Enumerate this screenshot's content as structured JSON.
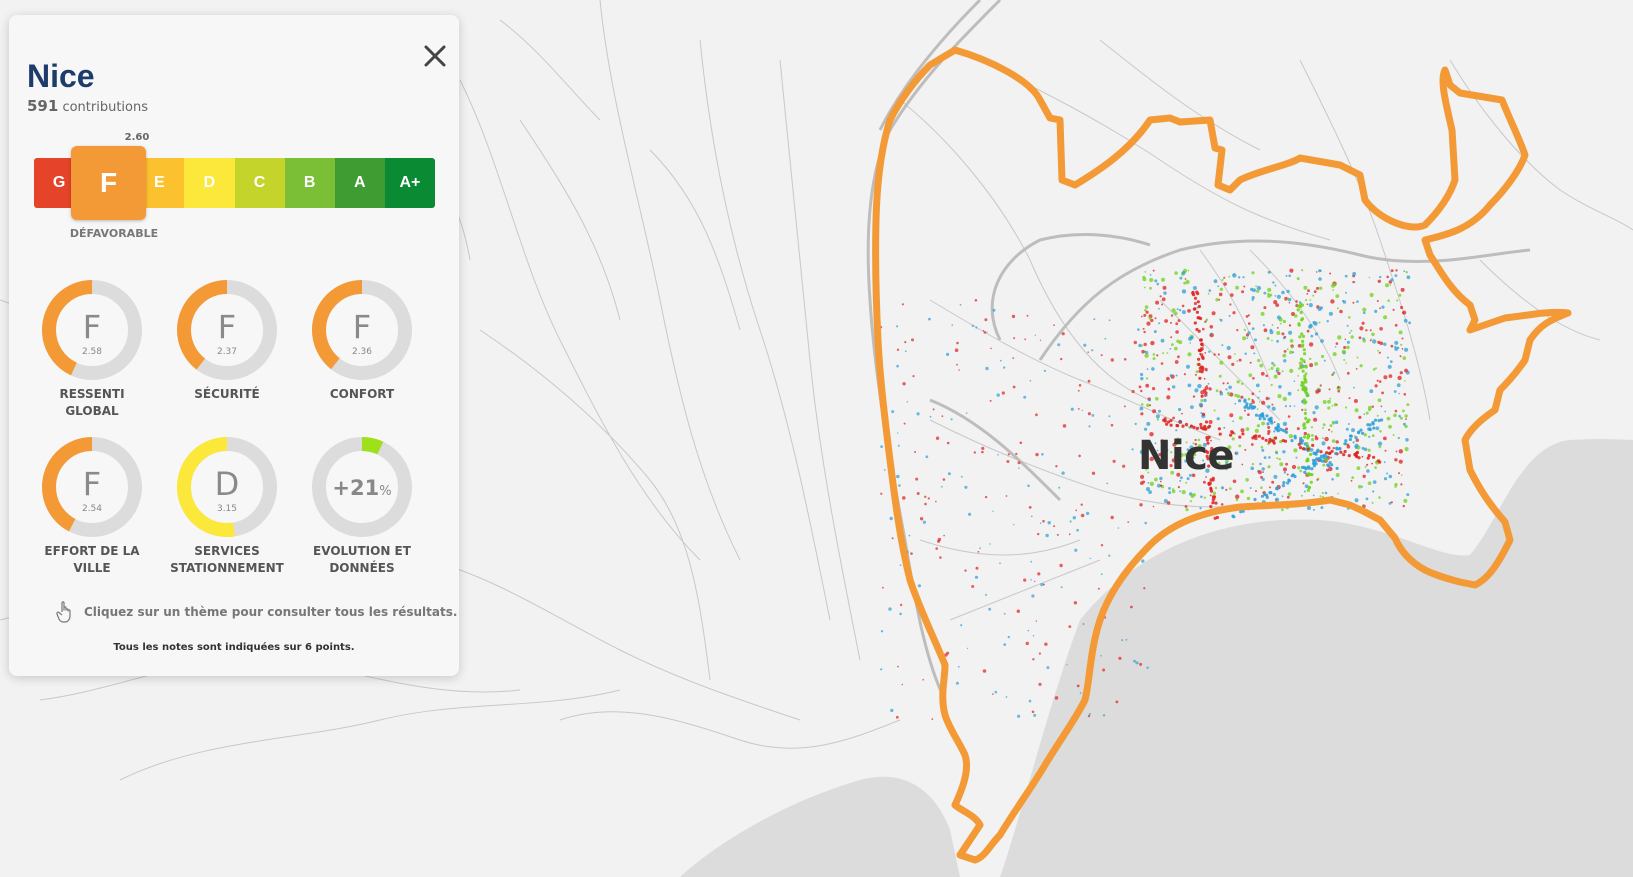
{
  "map": {
    "city_label": "Nice",
    "boundary_color": "#f39a37",
    "dot_colors": [
      "#e02020",
      "#2f9fd6",
      "#6fd21a"
    ]
  },
  "panel": {
    "city": "Nice",
    "contributions_count": "591",
    "contributions_label": "contributions",
    "overall_score": "2.60",
    "overall_grade": "F",
    "overall_word": "DÉFAVORABLE",
    "grade_scale": [
      {
        "label": "G",
        "color": "#e5442a"
      },
      {
        "label": "F",
        "color": "#f39a37"
      },
      {
        "label": "E",
        "color": "#fbc12f"
      },
      {
        "label": "D",
        "color": "#fbe83a"
      },
      {
        "label": "C",
        "color": "#c4d42b"
      },
      {
        "label": "B",
        "color": "#7bbf36"
      },
      {
        "label": "A",
        "color": "#3e9c33"
      },
      {
        "label": "A+",
        "color": "#0a8a32"
      }
    ],
    "gauges": [
      {
        "letter": "F",
        "score": "2.58",
        "label_line1": "RESSENTI",
        "label_line2": "GLOBAL",
        "fraction": 0.43,
        "color": "#f39a37"
      },
      {
        "letter": "F",
        "score": "2.37",
        "label_line1": "SÉCURITÉ",
        "label_line2": "",
        "fraction": 0.395,
        "color": "#f39a37"
      },
      {
        "letter": "F",
        "score": "2.36",
        "label_line1": "CONFORT",
        "label_line2": "",
        "fraction": 0.393,
        "color": "#f39a37"
      },
      {
        "letter": "F",
        "score": "2.54",
        "label_line1": "EFFORT DE LA",
        "label_line2": "VILLE",
        "fraction": 0.423,
        "color": "#f39a37"
      },
      {
        "letter": "D",
        "score": "3.15",
        "label_line1": "SERVICES",
        "label_line2": "STATIONNEMENT",
        "fraction": 0.525,
        "color": "#fbe83a"
      }
    ],
    "evolution": {
      "value": "+21",
      "unit": "%",
      "label_line1": "EVOLUTION ET",
      "label_line2": "DONNÉES",
      "fraction": 0.07,
      "color": "#9ee01a"
    },
    "hint": "Cliquez sur un thème pour consulter tous les résultats.",
    "note": "Tous les notes sont indiquées sur 6 points."
  }
}
